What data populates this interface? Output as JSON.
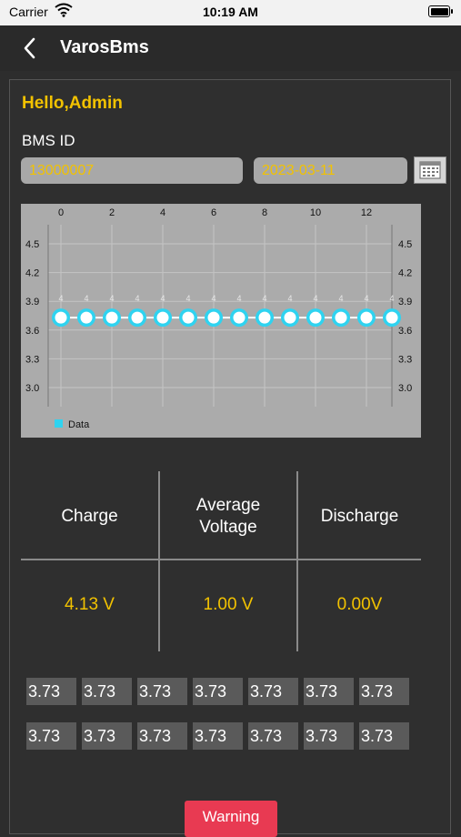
{
  "status_bar": {
    "carrier": "Carrier",
    "time": "10:19 AM"
  },
  "nav": {
    "title": "VarosBms"
  },
  "greeting": "Hello,Admin",
  "bms_id_label": "BMS ID",
  "bms_id_value": "13000007",
  "date_value": "2023-03-11",
  "colors": {
    "accent": "#f2c200",
    "warning": "#e83a52",
    "point": "#2fd3f0"
  },
  "chart_data": {
    "type": "line",
    "x_ticks": [
      "0",
      "2",
      "4",
      "6",
      "8",
      "10",
      "12"
    ],
    "y_ticks": [
      "4.5",
      "4.2",
      "3.9",
      "3.6",
      "3.3",
      "3.0"
    ],
    "x": [
      0,
      1,
      2,
      3,
      4,
      5,
      6,
      7,
      8,
      9,
      10,
      11,
      12,
      13
    ],
    "values": [
      3.73,
      3.73,
      3.73,
      3.73,
      3.73,
      3.73,
      3.73,
      3.73,
      3.73,
      3.73,
      3.73,
      3.73,
      3.73,
      3.73
    ],
    "point_labels": [
      "4",
      "4",
      "4",
      "4",
      "4",
      "4",
      "4",
      "4",
      "4",
      "4",
      "4",
      "4",
      "4",
      "4"
    ],
    "xlim": [
      -0.5,
      13
    ],
    "ylim": [
      2.8,
      4.7
    ],
    "grid": true,
    "legend": {
      "label": "Data",
      "position": "bottom-left"
    }
  },
  "stats": {
    "charge_label": "Charge",
    "avg_label_1": "Average",
    "avg_label_2": "Voltage",
    "discharge_label": "Discharge",
    "charge_value": "4.13 V",
    "avg_value": "1.00 V",
    "discharge_value": "0.00V"
  },
  "cells": [
    "3.73",
    "3.73",
    "3.73",
    "3.73",
    "3.73",
    "3.73",
    "3.73",
    "3.73",
    "3.73",
    "3.73",
    "3.73",
    "3.73",
    "3.73",
    "3.73"
  ],
  "warning_button": "Warning"
}
